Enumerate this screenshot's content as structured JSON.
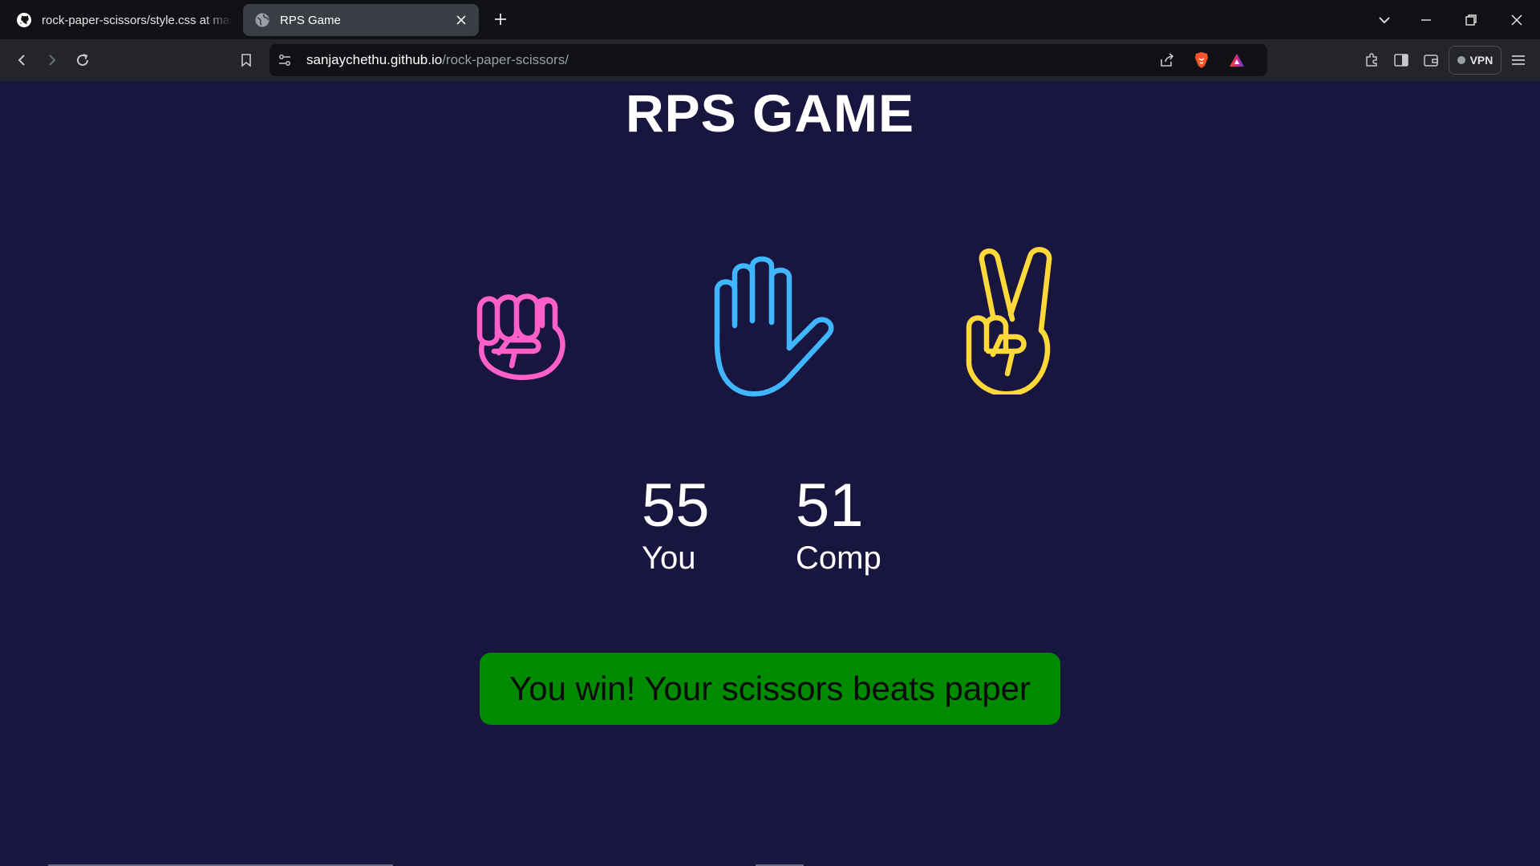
{
  "browser": {
    "tabs": [
      {
        "title": "rock-paper-scissors/style.css at main",
        "active": false,
        "icon": "github-icon"
      },
      {
        "title": "RPS Game",
        "active": true,
        "icon": "globe-icon"
      }
    ],
    "address": {
      "host": "sanjaychethu.github.io",
      "path": "/rock-paper-scissors/"
    },
    "vpn_label": "VPN"
  },
  "game": {
    "title": "RPS GAME",
    "choices": [
      {
        "name": "rock",
        "icon": "fist-icon",
        "color": "#ff5fc8"
      },
      {
        "name": "paper",
        "icon": "open-hand-icon",
        "color": "#3fb6ff"
      },
      {
        "name": "scissors",
        "icon": "peace-hand-icon",
        "color": "#ffd93a"
      }
    ],
    "scores": {
      "user_score": "55",
      "user_label": "You",
      "comp_score": "51",
      "comp_label": "Comp"
    },
    "result_message": "You win! Your scissors beats paper",
    "result_color": "#008a00"
  }
}
